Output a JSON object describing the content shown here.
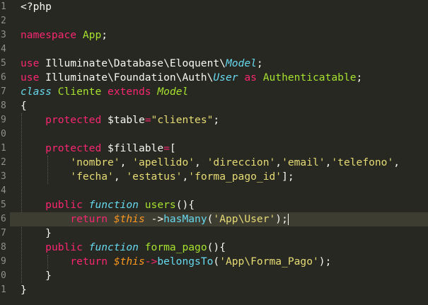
{
  "line_numbers": [
    "1",
    "2",
    "3",
    "4",
    "5",
    "6",
    "7",
    "8",
    "9",
    "0",
    "1",
    "2",
    "3",
    "4",
    "5",
    "6",
    "7",
    "8",
    "9",
    "0",
    "1"
  ],
  "code": {
    "l1": "<?php",
    "l3_kw": "namespace",
    "l3_ns": "App",
    "l3_end": ";",
    "l5_kw": "use",
    "l5_path": "Illuminate\\Database\\Eloquent\\",
    "l5_class": "Model",
    "l5_end": ";",
    "l6_kw": "use",
    "l6_path": "Illuminate\\Foundation\\Auth\\",
    "l6_class": "User",
    "l6_as": "as",
    "l6_alias": "Authenticatable",
    "l6_end": ";",
    "l7_kw": "class",
    "l7_name": "Cliente",
    "l7_ext": "extends",
    "l7_parent": "Model",
    "l8": "{",
    "l9_kw": "protected",
    "l9_var": "$table",
    "l9_eq": "=",
    "l9_str": "\"clientes\"",
    "l9_end": ";",
    "l11_kw": "protected",
    "l11_var": "$fillable",
    "l11_eq": "=",
    "l11_br": "[",
    "l12_s1": "'nombre'",
    "l12_c1": ", ",
    "l12_s2": "'apellido'",
    "l12_c2": ", ",
    "l12_s3": "'direccion'",
    "l12_c3": ",",
    "l12_s4": "'email'",
    "l12_c4": ",",
    "l12_s5": "'telefono'",
    "l12_c5": ",",
    "l13_s1": "'fecha'",
    "l13_c1": ", ",
    "l13_s2": "'estatus'",
    "l13_c2": ",",
    "l13_s3": "'forma_pago_id'",
    "l13_end": "];",
    "l15_kw": "public",
    "l15_fn": "function",
    "l15_name": "users",
    "l15_rest": "(){",
    "l16_kw": "return",
    "l16_this": "$this",
    "l16_arrow": " ->",
    "l16_call": "hasMany",
    "l16_open": "(",
    "l16_str": "'App\\User'",
    "l16_end": ");",
    "l17": "}",
    "l18_kw": "public",
    "l18_fn": "function",
    "l18_name": "forma_pago",
    "l18_rest": "(){",
    "l19_kw": "return",
    "l19_this": "$this",
    "l19_arrow": "->",
    "l19_call": "belongsTo",
    "l19_open": "(",
    "l19_str": "'App\\Forma_Pago'",
    "l19_end": ");",
    "l20": "}",
    "l21": "}"
  },
  "colors": {
    "background": "#272822",
    "active_line": "#3e3d32",
    "keyword": "#f92672",
    "class_green": "#a6e22e",
    "storage_blue": "#66d9ef",
    "string_yellow": "#e6db74",
    "variable_orange": "#fd971f",
    "line_number": "#8f908a"
  }
}
